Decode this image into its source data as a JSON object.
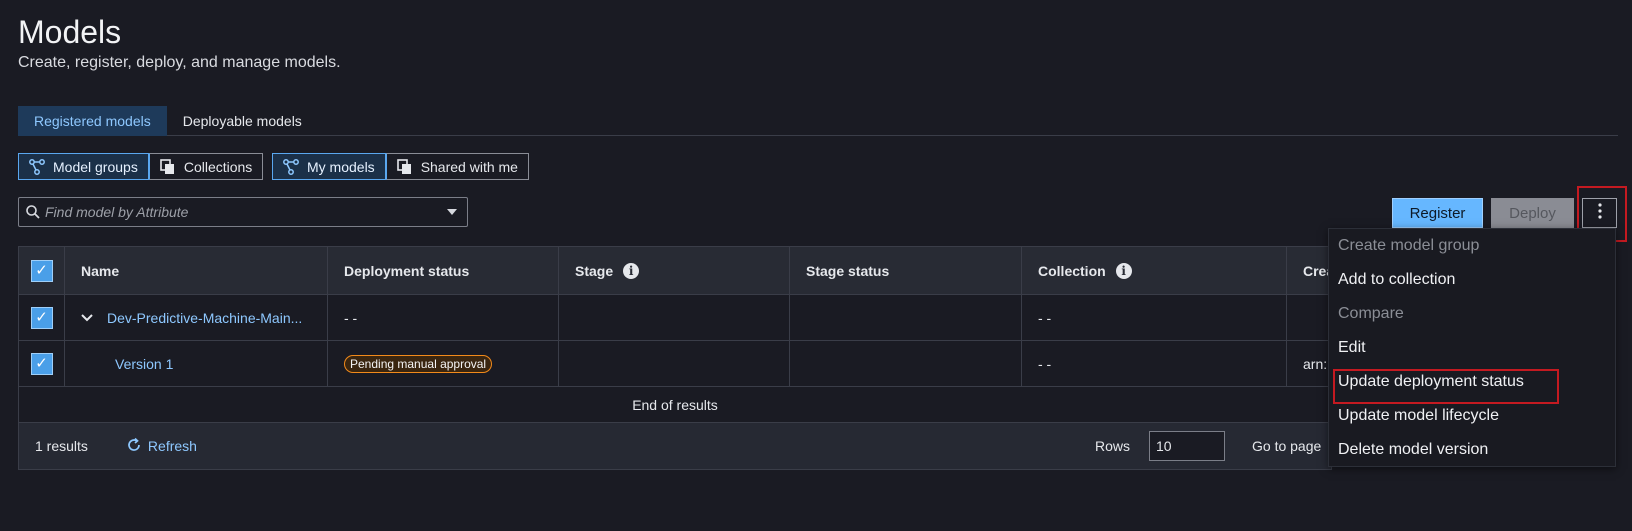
{
  "page": {
    "title": "Models",
    "subtitle": "Create, register, deploy, and manage models."
  },
  "tabs": [
    {
      "label": "Registered models",
      "active": true
    },
    {
      "label": "Deployable models",
      "active": false
    }
  ],
  "view_toggle": [
    {
      "label": "Model groups",
      "icon": "model-group-icon",
      "active": true
    },
    {
      "label": "Collections",
      "icon": "collections-icon",
      "active": false
    }
  ],
  "owner_toggle": [
    {
      "label": "My models",
      "icon": "model-group-icon",
      "active": true
    },
    {
      "label": "Shared with me",
      "icon": "collections-icon",
      "active": false
    }
  ],
  "search": {
    "placeholder": "Find model by Attribute"
  },
  "actions": {
    "register": "Register",
    "deploy": "Deploy"
  },
  "table": {
    "columns": [
      "Name",
      "Deployment status",
      "Stage",
      "Stage status",
      "Collection",
      "Crea"
    ],
    "rows": [
      {
        "name": "Dev-Predictive-Machine-Main...",
        "deployment_status": "- -",
        "stage": "",
        "stage_status": "",
        "collection": "- -",
        "created": "",
        "expandable": true
      },
      {
        "name": "Version 1",
        "deployment_status": "Pending manual approval",
        "stage": "",
        "stage_status": "",
        "collection": "- -",
        "created": "arn:",
        "expandable": false
      }
    ],
    "end_text": "End of results"
  },
  "footer": {
    "results": "1 results",
    "refresh": "Refresh",
    "rows_label": "Rows",
    "rows_value": "10",
    "goto": "Go to page"
  },
  "menu": {
    "items": [
      {
        "label": "Create model group",
        "disabled": true
      },
      {
        "label": "Add to collection",
        "disabled": false
      },
      {
        "label": "Compare",
        "disabled": true
      },
      {
        "label": "Edit",
        "disabled": false
      },
      {
        "label": "Update deployment status",
        "disabled": false
      },
      {
        "label": "Update model lifecycle",
        "disabled": false
      },
      {
        "label": "Delete model version",
        "disabled": false
      }
    ]
  },
  "colors": {
    "accent": "#66b7ff",
    "highlight": "#c41a21",
    "badge_border": "#f28a1a"
  }
}
